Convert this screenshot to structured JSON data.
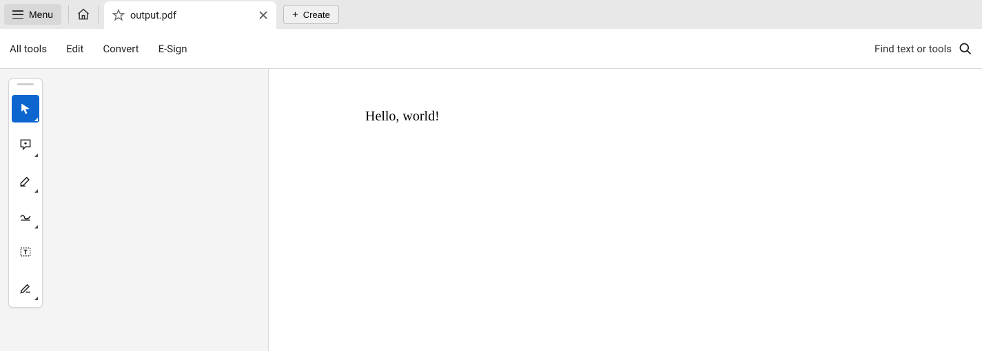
{
  "header": {
    "menu_label": "Menu",
    "tab_title": "output.pdf",
    "create_label": "Create"
  },
  "toolbar": {
    "items": [
      "All tools",
      "Edit",
      "Convert",
      "E-Sign"
    ],
    "search_label": "Find text or tools"
  },
  "tools": [
    {
      "name": "select-tool",
      "active": true,
      "corner": true
    },
    {
      "name": "comment-tool",
      "active": false,
      "corner": true
    },
    {
      "name": "highlight-tool",
      "active": false,
      "corner": true
    },
    {
      "name": "draw-tool",
      "active": false,
      "corner": true
    },
    {
      "name": "text-box-tool",
      "active": false,
      "corner": false
    },
    {
      "name": "fill-sign-tool",
      "active": false,
      "corner": true
    }
  ],
  "document": {
    "content": "Hello, world!"
  }
}
